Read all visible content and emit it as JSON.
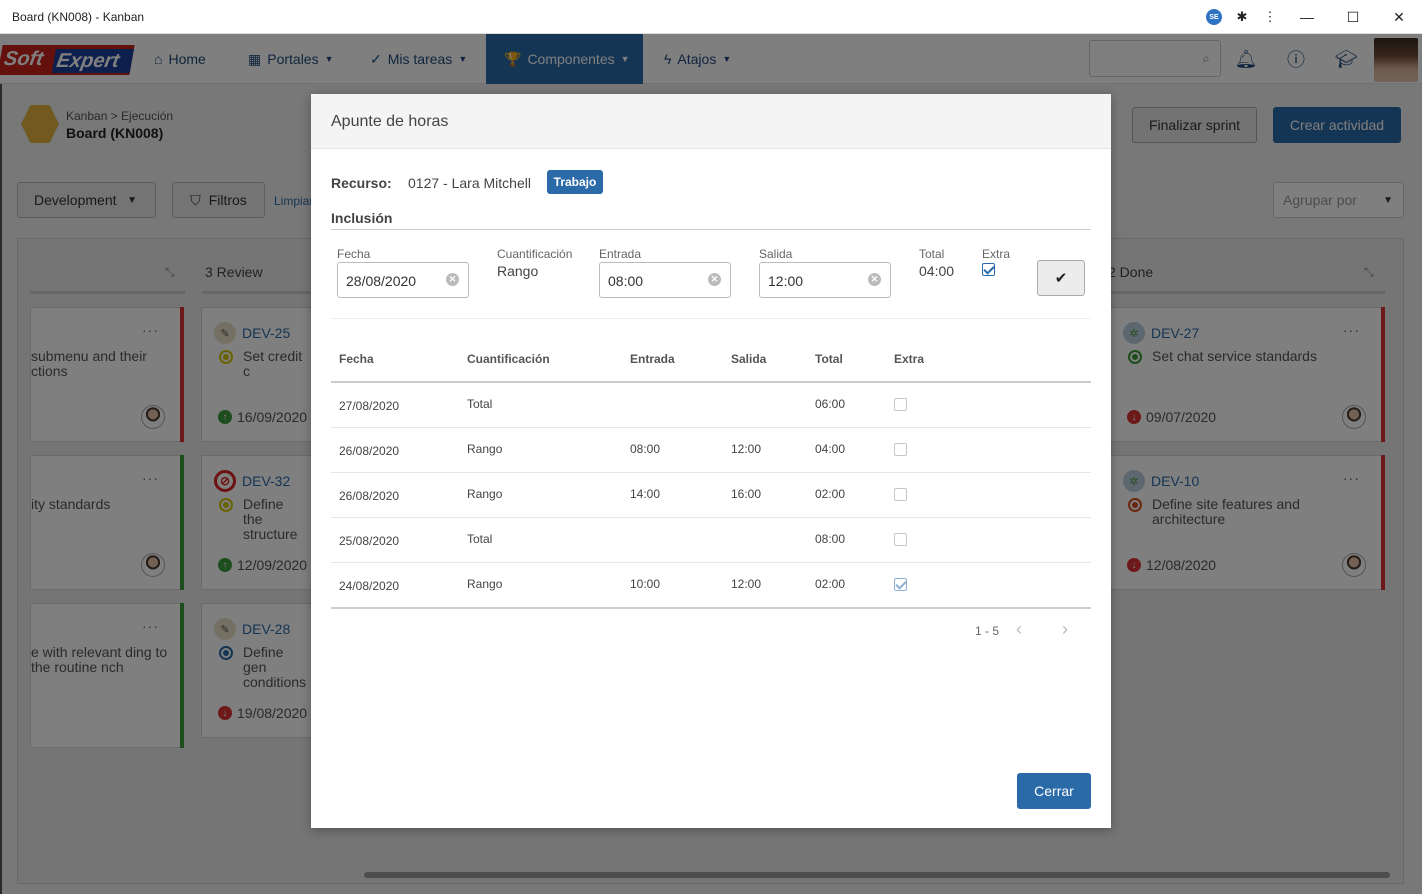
{
  "window": {
    "title": "Board (KN008) - Kanban",
    "minimize": "—",
    "maximize": "☐",
    "close": "✕"
  },
  "extensions": {
    "se": "SE"
  },
  "logo": {
    "soft": "Soft",
    "expert": "Expert"
  },
  "nav": {
    "items": [
      {
        "label": "Home",
        "icon": "home-icon"
      },
      {
        "label": "Portales",
        "icon": "grid-icon"
      },
      {
        "label": "Mis tareas",
        "icon": "check-icon"
      },
      {
        "label": "Componentes",
        "icon": "trophy-icon"
      },
      {
        "label": "Atajos",
        "icon": "bolt-icon"
      }
    ],
    "active": "Componentes"
  },
  "breadcrumb": {
    "path": "Kanban > Ejecución",
    "title": "Board (KN008)"
  },
  "actions": {
    "finalizar": "Finalizar sprint",
    "crear": "Crear actividad"
  },
  "filters": {
    "development": "Development",
    "filtros": "Filtros",
    "limpiar": "Limpiar",
    "agrupar_placeholder": "Agrupar por"
  },
  "columns": {
    "review": "3 Review",
    "done": "2 Done"
  },
  "cards": [
    {
      "id": "",
      "text": "submenu and their ctions",
      "date": ""
    },
    {
      "id": "DEV-25",
      "text": "Set credit c",
      "date": "16/09/2020"
    },
    {
      "id": "DEV-27",
      "text": "Set chat service standards",
      "date": "09/07/2020"
    },
    {
      "id": "",
      "text": "ity standards",
      "date": ""
    },
    {
      "id": "DEV-32",
      "text": "Define the structure",
      "date": "12/09/2020"
    },
    {
      "id": "DEV-10",
      "text": "Define site features and architecture",
      "date": "12/08/2020"
    },
    {
      "id": "",
      "text": "e with relevant ding to the routine nch",
      "date": ""
    },
    {
      "id": "DEV-28",
      "text": "Define gen conditions",
      "date": "19/08/2020"
    }
  ],
  "modal": {
    "title": "Apunte de horas",
    "recurso_label": "Recurso:",
    "recurso_value": "0127 - Lara Mitchell",
    "badge": "Trabajo",
    "inclusion": "Inclusión",
    "form": {
      "fecha_label": "Fecha",
      "fecha_value": "28/08/2020",
      "cuant_label": "Cuantificación",
      "cuant_value": "Rango",
      "entrada_label": "Entrada",
      "entrada_value": "08:00",
      "salida_label": "Salida",
      "salida_value": "12:00",
      "total_label": "Total",
      "total_value": "04:00",
      "extra_label": "Extra",
      "extra_checked": true
    },
    "table": {
      "headers": [
        "Fecha",
        "Cuantificación",
        "Entrada",
        "Salida",
        "Total",
        "Extra"
      ],
      "rows": [
        {
          "fecha": "27/08/2020",
          "cuant": "Total",
          "entrada": "",
          "salida": "",
          "total": "06:00",
          "extra": false
        },
        {
          "fecha": "26/08/2020",
          "cuant": "Rango",
          "entrada": "08:00",
          "salida": "12:00",
          "total": "04:00",
          "extra": false
        },
        {
          "fecha": "26/08/2020",
          "cuant": "Rango",
          "entrada": "14:00",
          "salida": "16:00",
          "total": "02:00",
          "extra": false
        },
        {
          "fecha": "25/08/2020",
          "cuant": "Total",
          "entrada": "",
          "salida": "",
          "total": "08:00",
          "extra": false
        },
        {
          "fecha": "24/08/2020",
          "cuant": "Rango",
          "entrada": "10:00",
          "salida": "12:00",
          "total": "02:00",
          "extra": true
        }
      ]
    },
    "pager": "1 - 5",
    "close": "Cerrar"
  }
}
